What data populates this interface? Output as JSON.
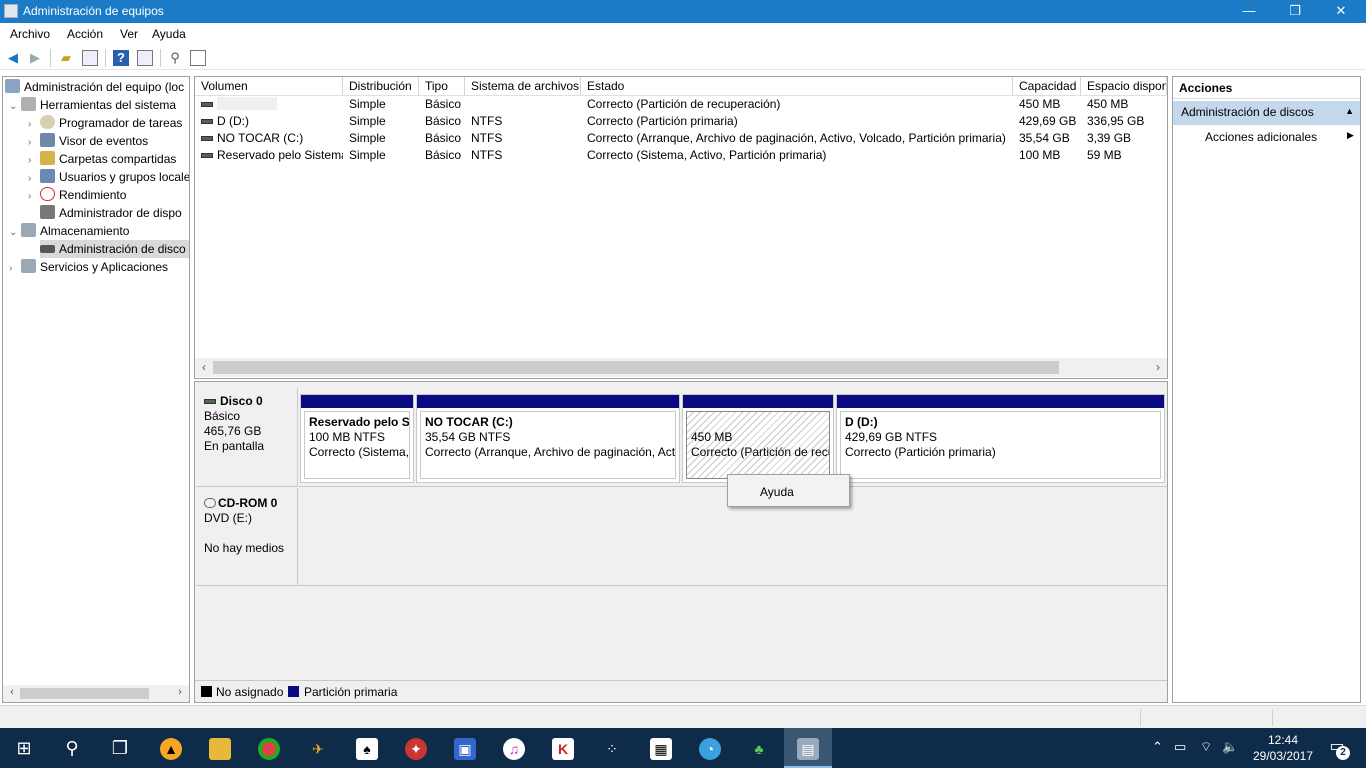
{
  "window": {
    "title": "Administración de equipos",
    "controls": {
      "minimize": "—",
      "maximize": "❐",
      "close": "✕"
    }
  },
  "menu": [
    "Archivo",
    "Acción",
    "Ver",
    "Ayuda"
  ],
  "toolbar_icons": [
    "back-arrow-icon",
    "forward-arrow-icon",
    "up-folder-icon",
    "show-hide-tree-icon",
    "help-icon",
    "show-hide-action-pane-icon",
    "connect-icon",
    "properties-icon"
  ],
  "tree": {
    "root": "Administración del equipo (loc",
    "items": [
      {
        "label": "Herramientas del sistema",
        "icon": "tools-icon"
      },
      {
        "label": "Programador de tareas",
        "icon": "clock-icon"
      },
      {
        "label": "Visor de eventos",
        "icon": "event-viewer-icon"
      },
      {
        "label": "Carpetas compartidas",
        "icon": "shared-folder-icon"
      },
      {
        "label": "Usuarios y grupos locale",
        "icon": "users-icon"
      },
      {
        "label": "Rendimiento",
        "icon": "performance-icon"
      },
      {
        "label": "Administrador de dispo",
        "icon": "device-manager-icon"
      },
      {
        "label": "Almacenamiento",
        "icon": "storage-icon"
      },
      {
        "label": "Administración de disco",
        "icon": "disk-icon"
      },
      {
        "label": "Servicios y Aplicaciones",
        "icon": "services-icon"
      }
    ]
  },
  "volumes": {
    "columns": [
      "Volumen",
      "Distribución",
      "Tipo",
      "Sistema de archivos",
      "Estado",
      "Capacidad",
      "Espacio dispon"
    ],
    "rows": [
      [
        "",
        "Simple",
        "Básico",
        "",
        "Correcto (Partición de recuperación)",
        "450 MB",
        "450 MB"
      ],
      [
        "D (D:)",
        "Simple",
        "Básico",
        "NTFS",
        "Correcto (Partición primaria)",
        "429,69 GB",
        "336,95 GB"
      ],
      [
        "NO TOCAR (C:)",
        "Simple",
        "Básico",
        "NTFS",
        "Correcto (Arranque, Archivo de paginación, Activo, Volcado, Partición primaria)",
        "35,54 GB",
        "3,39 GB"
      ],
      [
        "Reservado pelo Sistema",
        "Simple",
        "Básico",
        "NTFS",
        "Correcto (Sistema, Activo, Partición primaria)",
        "100 MB",
        "59 MB"
      ]
    ]
  },
  "disks": [
    {
      "name": "Disco 0",
      "lines": [
        "Básico",
        "465,76 GB",
        "En pantalla"
      ],
      "partitions": [
        {
          "name": "Reservado pelo Si",
          "size": "100 MB NTFS",
          "status": "Correcto (Sistema,"
        },
        {
          "name": "NO TOCAR  (C:)",
          "size": "35,54 GB NTFS",
          "status": "Correcto (Arranque, Archivo de paginación, Act"
        },
        {
          "name": "",
          "size": "450 MB",
          "status": "Correcto (Partición de recu"
        },
        {
          "name": "D  (D:)",
          "size": "429,69 GB NTFS",
          "status": "Correcto (Partición primaria)"
        }
      ]
    },
    {
      "name": "CD-ROM 0",
      "lines": [
        "DVD (E:)",
        "",
        "No hay medios"
      ]
    }
  ],
  "legend": [
    {
      "label": "No asignado",
      "color": "#000000"
    },
    {
      "label": "Partición primaria",
      "color": "#0a0a82"
    }
  ],
  "context_menu": {
    "item": "Ayuda"
  },
  "actions": {
    "header": "Acciones",
    "section": "Administración de discos",
    "more": "Acciones adicionales"
  },
  "taskbar": {
    "apps": [
      "windows-start-icon",
      "search-icon",
      "task-view-icon",
      "avast-icon",
      "file-explorer-icon",
      "chrome-icon",
      "app-icon",
      "solitaire-icon",
      "antivirus-icon",
      "save-app-icon",
      "itunes-icon",
      "kaspersky-icon",
      "dots-app-icon",
      "calculator-icon",
      "browser-icon",
      "clover-icon",
      "computer-management-icon"
    ],
    "time": "12:44",
    "date": "29/03/2017",
    "notifications": "2"
  },
  "colors": {
    "titlebar": "#1b7bc6",
    "primary_partition": "#0a0a82",
    "taskbar": "#0f2b4a",
    "selection": "#c3d8ea"
  }
}
